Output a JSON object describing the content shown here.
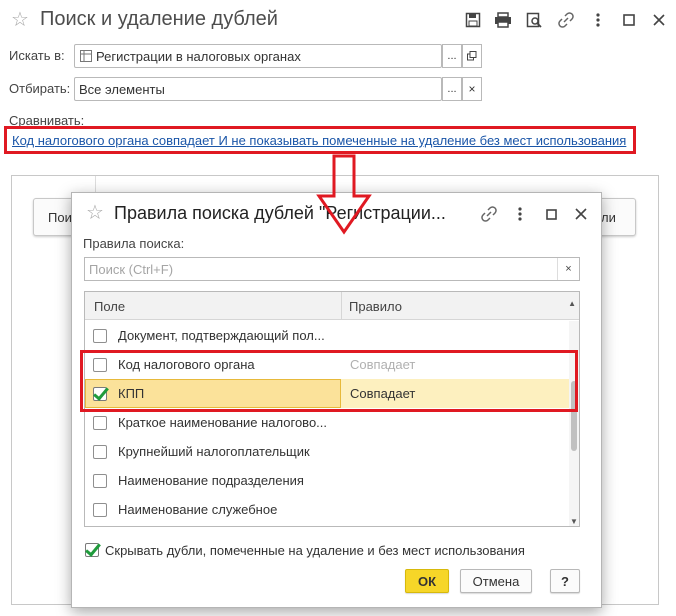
{
  "main_window": {
    "title": "Поиск и удаление дублей",
    "search_in_label": "Искать в:",
    "search_in_value": "Регистрации в налоговых органах",
    "filter_label": "Отбирать:",
    "filter_value": "Все элементы",
    "compare_label": "Сравнивать:",
    "compare_link": "Код налогового органа совпадает И не показывать помеченные на удаление без мест использования",
    "bg_button_left": "Пои",
    "bg_button_right": "ли"
  },
  "dialog": {
    "title": "Правила поиска дублей \"Регистрации...",
    "rules_label": "Правила поиска:",
    "search_placeholder": "Поиск (Ctrl+F)",
    "columns": {
      "field": "Поле",
      "rule": "Правило"
    },
    "rows": [
      {
        "field": "Документ, подтверждающий пол...",
        "rule": "",
        "checked": false
      },
      {
        "field": "Код налогового органа",
        "rule": "Совпадает",
        "checked": false
      },
      {
        "field": "КПП",
        "rule": "Совпадает",
        "checked": true
      },
      {
        "field": "Краткое наименование налогово...",
        "rule": "",
        "checked": false
      },
      {
        "field": "Крупнейший налогоплательщик",
        "rule": "",
        "checked": false
      },
      {
        "field": "Наименование подразделения",
        "rule": "",
        "checked": false
      },
      {
        "field": "Наименование служебное",
        "rule": "",
        "checked": false
      }
    ],
    "hide_duplicates_label": "Скрывать дубли, помеченные на удаление и без мест использования",
    "hide_duplicates_checked": true,
    "ok_label": "ОК",
    "cancel_label": "Отмена",
    "help_label": "?"
  },
  "colors": {
    "highlight": "#e01922",
    "selected_row": "#fdf0bf",
    "primary_button": "#f6d628",
    "link": "#1b56a8"
  },
  "icons": [
    "star-icon",
    "save-icon",
    "print-icon",
    "preview-icon",
    "link-icon",
    "more-icon",
    "maximize-icon",
    "close-icon",
    "select-icon",
    "open-icon",
    "clear-icon",
    "arrow-down-icon"
  ]
}
